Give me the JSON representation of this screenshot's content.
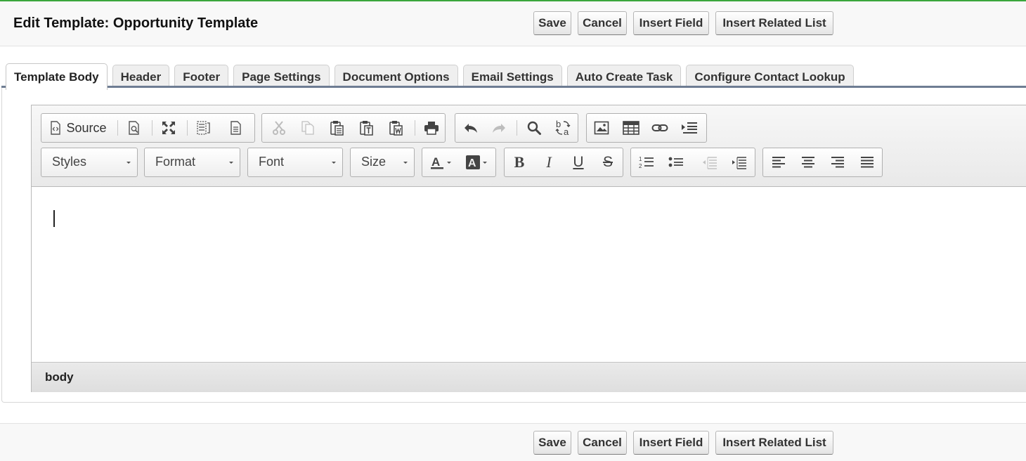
{
  "header": {
    "title": "Edit Template: Opportunity Template",
    "buttons": {
      "save": "Save",
      "cancel": "Cancel",
      "insert_field": "Insert Field",
      "insert_related_list": "Insert Related List"
    }
  },
  "tabs": [
    {
      "label": "Template Body",
      "active": true
    },
    {
      "label": "Header"
    },
    {
      "label": "Footer"
    },
    {
      "label": "Page Settings"
    },
    {
      "label": "Document Options"
    },
    {
      "label": "Email Settings"
    },
    {
      "label": "Auto Create Task"
    },
    {
      "label": "Configure Contact Lookup"
    }
  ],
  "editor": {
    "toolbar": {
      "source_label": "Source",
      "row1_icons": [
        "source-icon",
        "preview-icon",
        "maximize-icon",
        "show-blocks-icon",
        "templates-icon",
        "cut-icon",
        "copy-icon",
        "paste-icon",
        "paste-text-icon",
        "paste-word-icon",
        "print-icon",
        "undo-icon",
        "redo-icon",
        "find-icon",
        "replace-icon",
        "image-icon",
        "table-icon",
        "link-icon",
        "indent-list-icon"
      ],
      "combos": {
        "styles": "Styles",
        "format": "Format",
        "font": "Font",
        "size": "Size"
      },
      "row2_icons": [
        "text-color-icon",
        "background-color-icon",
        "bold-icon",
        "italic-icon",
        "underline-icon",
        "strikethrough-icon",
        "numbered-list-icon",
        "bulleted-list-icon",
        "decrease-indent-icon",
        "increase-indent-icon",
        "align-left-icon",
        "align-center-icon",
        "align-right-icon",
        "justify-icon"
      ]
    },
    "status_path": "body"
  },
  "footer": {
    "buttons": {
      "save": "Save",
      "cancel": "Cancel",
      "insert_field": "Insert Field",
      "insert_related_list": "Insert Related List"
    }
  }
}
